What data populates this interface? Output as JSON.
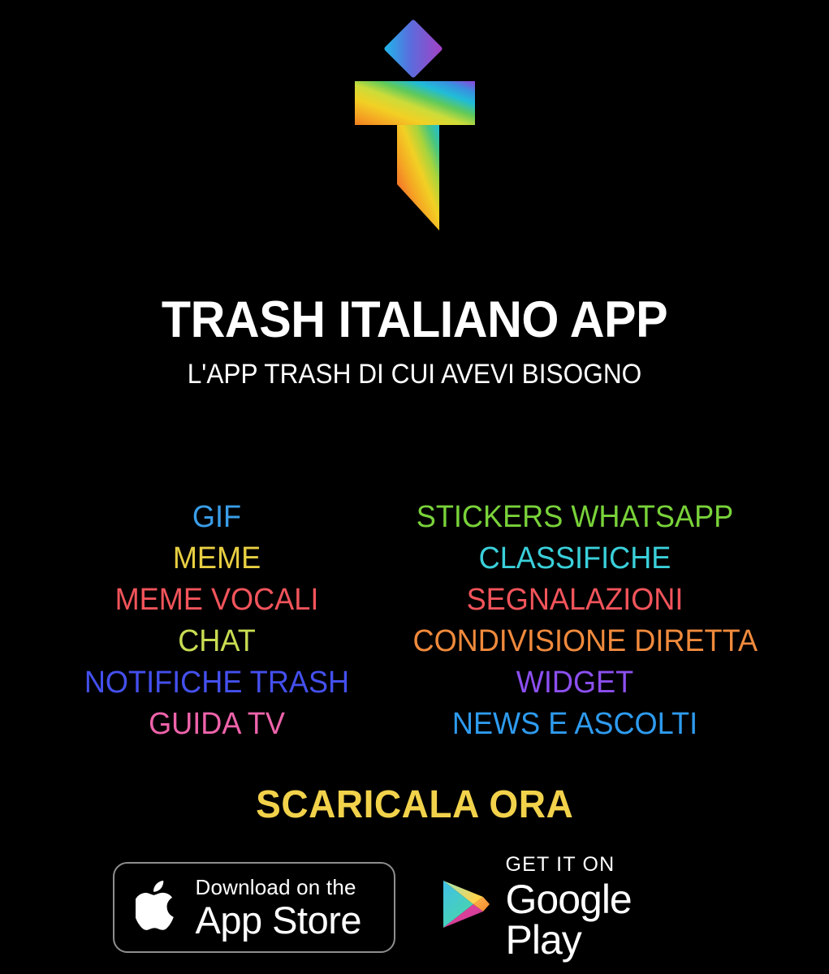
{
  "background_color": "#000000",
  "logo": {
    "name": "trash-italiano-logo",
    "shape": "letter-t-with-diamond-dot",
    "gradient_colors": [
      "#f5a623",
      "#f2d024",
      "#8ed44a",
      "#2bb6d8",
      "#3a8fe0",
      "#8b4fe0"
    ],
    "diamond_gradient_colors": [
      "#2bb6ea",
      "#6a5bdd",
      "#a04bd0"
    ]
  },
  "header": {
    "title": "TRASH ITALIANO APP",
    "subtitle": "L'APP TRASH DI CUI AVEVI BISOGNO",
    "title_color": "#ffffff",
    "subtitle_color": "#ffffff"
  },
  "features": {
    "left_column": [
      {
        "label": "GIF",
        "color": "#3a9ee8"
      },
      {
        "label": "MEME",
        "color": "#e8cf42"
      },
      {
        "label": "MEME VOCALI",
        "color": "#f2545b"
      },
      {
        "label": "CHAT",
        "color": "#c9dc52"
      },
      {
        "label": "NOTIFICHE TRASH",
        "color": "#4450ee"
      },
      {
        "label": "GUIDA TV",
        "color": "#ef63ab"
      }
    ],
    "right_column": [
      {
        "label": "STICKERS WHATSAPP",
        "color": "#79d239"
      },
      {
        "label": "CLASSIFICHE",
        "color": "#3ad0da"
      },
      {
        "label": "SEGNALAZIONI",
        "color": "#f2545b"
      },
      {
        "label": "CONDIVISIONE DIRETTA",
        "color": "#f08a3c"
      },
      {
        "label": "WIDGET",
        "color": "#8c4ff0"
      },
      {
        "label": "NEWS E ASCOLTI",
        "color": "#2e9bef"
      }
    ]
  },
  "cta": {
    "label": "SCARICALA ORA",
    "color": "#f2d24b"
  },
  "badges": {
    "app_store": {
      "icon": "apple-icon",
      "line1": "Download on the",
      "line2": "App Store",
      "border_color": "#8e8e8e"
    },
    "google_play": {
      "icon": "google-play-icon",
      "line1": "GET IT ON",
      "line2": "Google Play",
      "icon_colors": [
        "#00d3b4",
        "#5bd8a0",
        "#ffce46",
        "#f4892f",
        "#ee4695",
        "#2196f3"
      ]
    }
  }
}
